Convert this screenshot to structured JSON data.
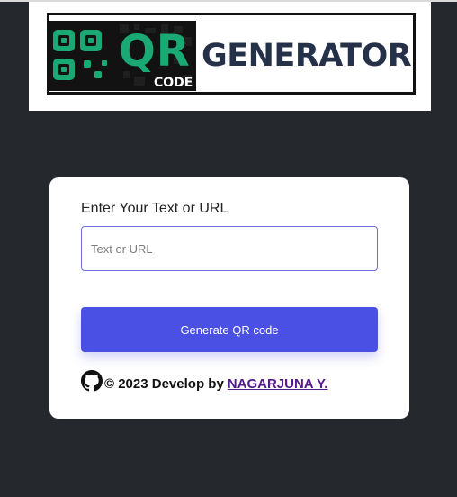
{
  "banner": {
    "logo_qr": "QR",
    "logo_code": "CODE",
    "title": "GENERATOR"
  },
  "form": {
    "label": "Enter Your Text or URL",
    "input_placeholder": "Text or URL",
    "input_value": "",
    "button_label": "Generate QR code"
  },
  "footer": {
    "icon": "github-icon",
    "copyright": "© 2023 Develop by",
    "author": "NAGARJUNA Y."
  },
  "colors": {
    "page_background": "#25282d",
    "logo_green": "#1aa874",
    "title_navy": "#243148",
    "button_accent": "#4b50e4",
    "link_visited": "#551a8b"
  }
}
